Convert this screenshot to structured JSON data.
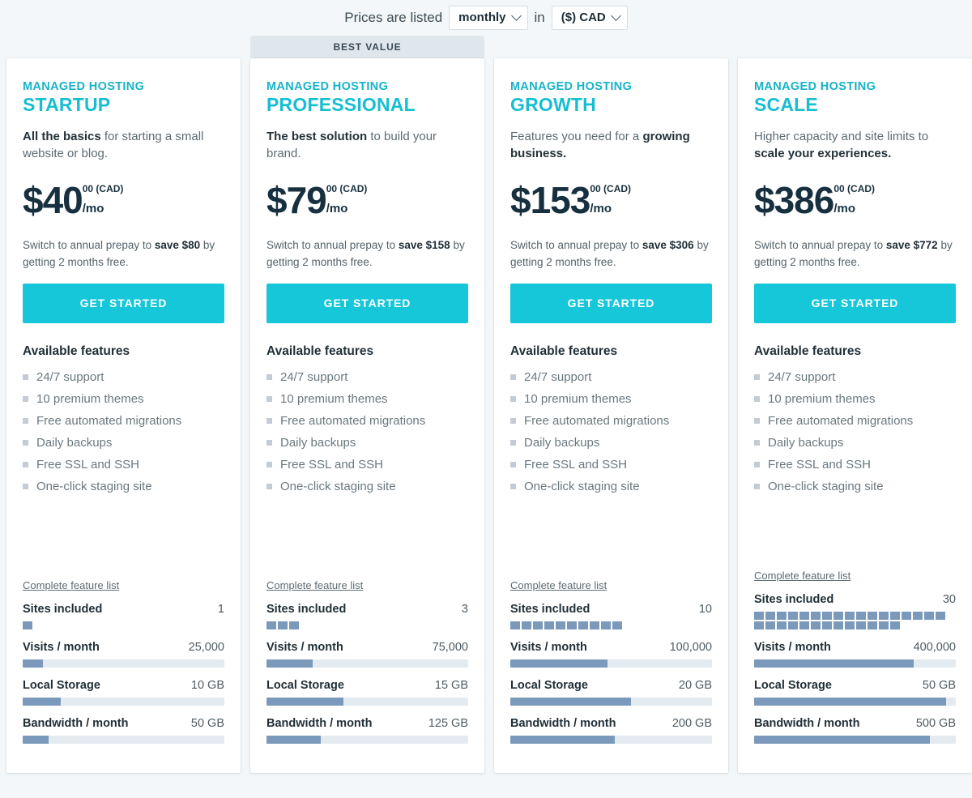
{
  "toolbar": {
    "lead_text": "Prices are listed",
    "period_value": "monthly",
    "join_text": "in",
    "currency_value": "($) CAD"
  },
  "ribbon": {
    "best_value": "BEST VALUE"
  },
  "labels": {
    "features_title": "Available features",
    "complete_list": "Complete feature list",
    "cta": "GET STARTED",
    "eyebrow": "MANAGED HOSTING",
    "metric_sites": "Sites included",
    "metric_visits": "Visits / month",
    "metric_storage": "Local Storage",
    "metric_bandwidth": "Bandwidth / month"
  },
  "colors": {
    "brand_cyan": "#16bed2",
    "cta_cyan": "#16c6d9",
    "bar_blue": "#7b99ba",
    "track_grey": "#e3eaf0",
    "page_bg": "#f4f7f9",
    "ribbon_bg": "#dfe6ec",
    "heading_dark": "#1f2e37"
  },
  "plans": [
    {
      "eyebrow": "MANAGED HOSTING",
      "name": "STARTUP",
      "desc_bold": "All the basics",
      "desc_rest": " for starting a small website or blog.",
      "price_main": "$40",
      "price_cents": "00 (CAD)",
      "price_per": "/mo",
      "savings_pre": "Switch to annual prepay to ",
      "savings_bold": "save $80",
      "savings_post": " by getting 2 months free.",
      "cta": "GET STARTED",
      "featured": false,
      "features": [
        "24/7 support",
        "10 premium themes",
        "Free automated migrations",
        "Daily backups",
        "Free SSL and SSH",
        "One-click staging site"
      ],
      "sites_label": "Sites included",
      "sites_value": "1",
      "sites_blocks": 1,
      "metrics": [
        {
          "label": "Visits / month",
          "value": "25,000",
          "pct": 10
        },
        {
          "label": "Local Storage",
          "value": "10 GB",
          "pct": 19
        },
        {
          "label": "Bandwidth / month",
          "value": "50 GB",
          "pct": 13
        }
      ]
    },
    {
      "eyebrow": "MANAGED HOSTING",
      "name": "PROFESSIONAL",
      "desc_bold": "The best solution",
      "desc_rest": " to build your brand.",
      "price_main": "$79",
      "price_cents": "00 (CAD)",
      "price_per": "/mo",
      "savings_pre": "Switch to annual prepay to ",
      "savings_bold": "save $158",
      "savings_post": " by getting 2 months free.",
      "cta": "GET STARTED",
      "featured": true,
      "features": [
        "24/7 support",
        "10 premium themes",
        "Free automated migrations",
        "Daily backups",
        "Free SSL and SSH",
        "One-click staging site"
      ],
      "sites_label": "Sites included",
      "sites_value": "3",
      "sites_blocks": 3,
      "metrics": [
        {
          "label": "Visits / month",
          "value": "75,000",
          "pct": 23
        },
        {
          "label": "Local Storage",
          "value": "15 GB",
          "pct": 38
        },
        {
          "label": "Bandwidth / month",
          "value": "125 GB",
          "pct": 27
        }
      ]
    },
    {
      "eyebrow": "MANAGED HOSTING",
      "name": "GROWTH",
      "desc_bold": "",
      "desc_rest": "",
      "desc_pre": "Features you need for a ",
      "desc_bold2": "growing business.",
      "price_main": "$153",
      "price_cents": "00 (CAD)",
      "price_per": "/mo",
      "savings_pre": "Switch to annual prepay to ",
      "savings_bold": "save $306",
      "savings_post": " by getting 2 months free.",
      "cta": "GET STARTED",
      "featured": false,
      "features": [
        "24/7 support",
        "10 premium themes",
        "Free automated migrations",
        "Daily backups",
        "Free SSL and SSH",
        "One-click staging site"
      ],
      "sites_label": "Sites included",
      "sites_value": "10",
      "sites_blocks": 10,
      "metrics": [
        {
          "label": "Visits / month",
          "value": "100,000",
          "pct": 48
        },
        {
          "label": "Local Storage",
          "value": "20 GB",
          "pct": 60
        },
        {
          "label": "Bandwidth / month",
          "value": "200 GB",
          "pct": 52
        }
      ]
    },
    {
      "eyebrow": "MANAGED HOSTING",
      "name": "SCALE",
      "desc_bold": "",
      "desc_rest": "",
      "desc_pre": "Higher capacity and site limits to ",
      "desc_bold2": "scale your experiences.",
      "price_main": "$386",
      "price_cents": "00 (CAD)",
      "price_per": "/mo",
      "savings_pre": "Switch to annual prepay to ",
      "savings_bold": "save $772",
      "savings_post": " by getting 2 months free.",
      "cta": "GET STARTED",
      "featured": false,
      "features": [
        "24/7 support",
        "10 premium themes",
        "Free automated migrations",
        "Daily backups",
        "Free SSL and SSH",
        "One-click staging site"
      ],
      "sites_label": "Sites included",
      "sites_value": "30",
      "sites_blocks": 30,
      "metrics": [
        {
          "label": "Visits / month",
          "value": "400,000",
          "pct": 79
        },
        {
          "label": "Local Storage",
          "value": "50 GB",
          "pct": 95
        },
        {
          "label": "Bandwidth / month",
          "value": "500 GB",
          "pct": 87
        }
      ]
    }
  ]
}
